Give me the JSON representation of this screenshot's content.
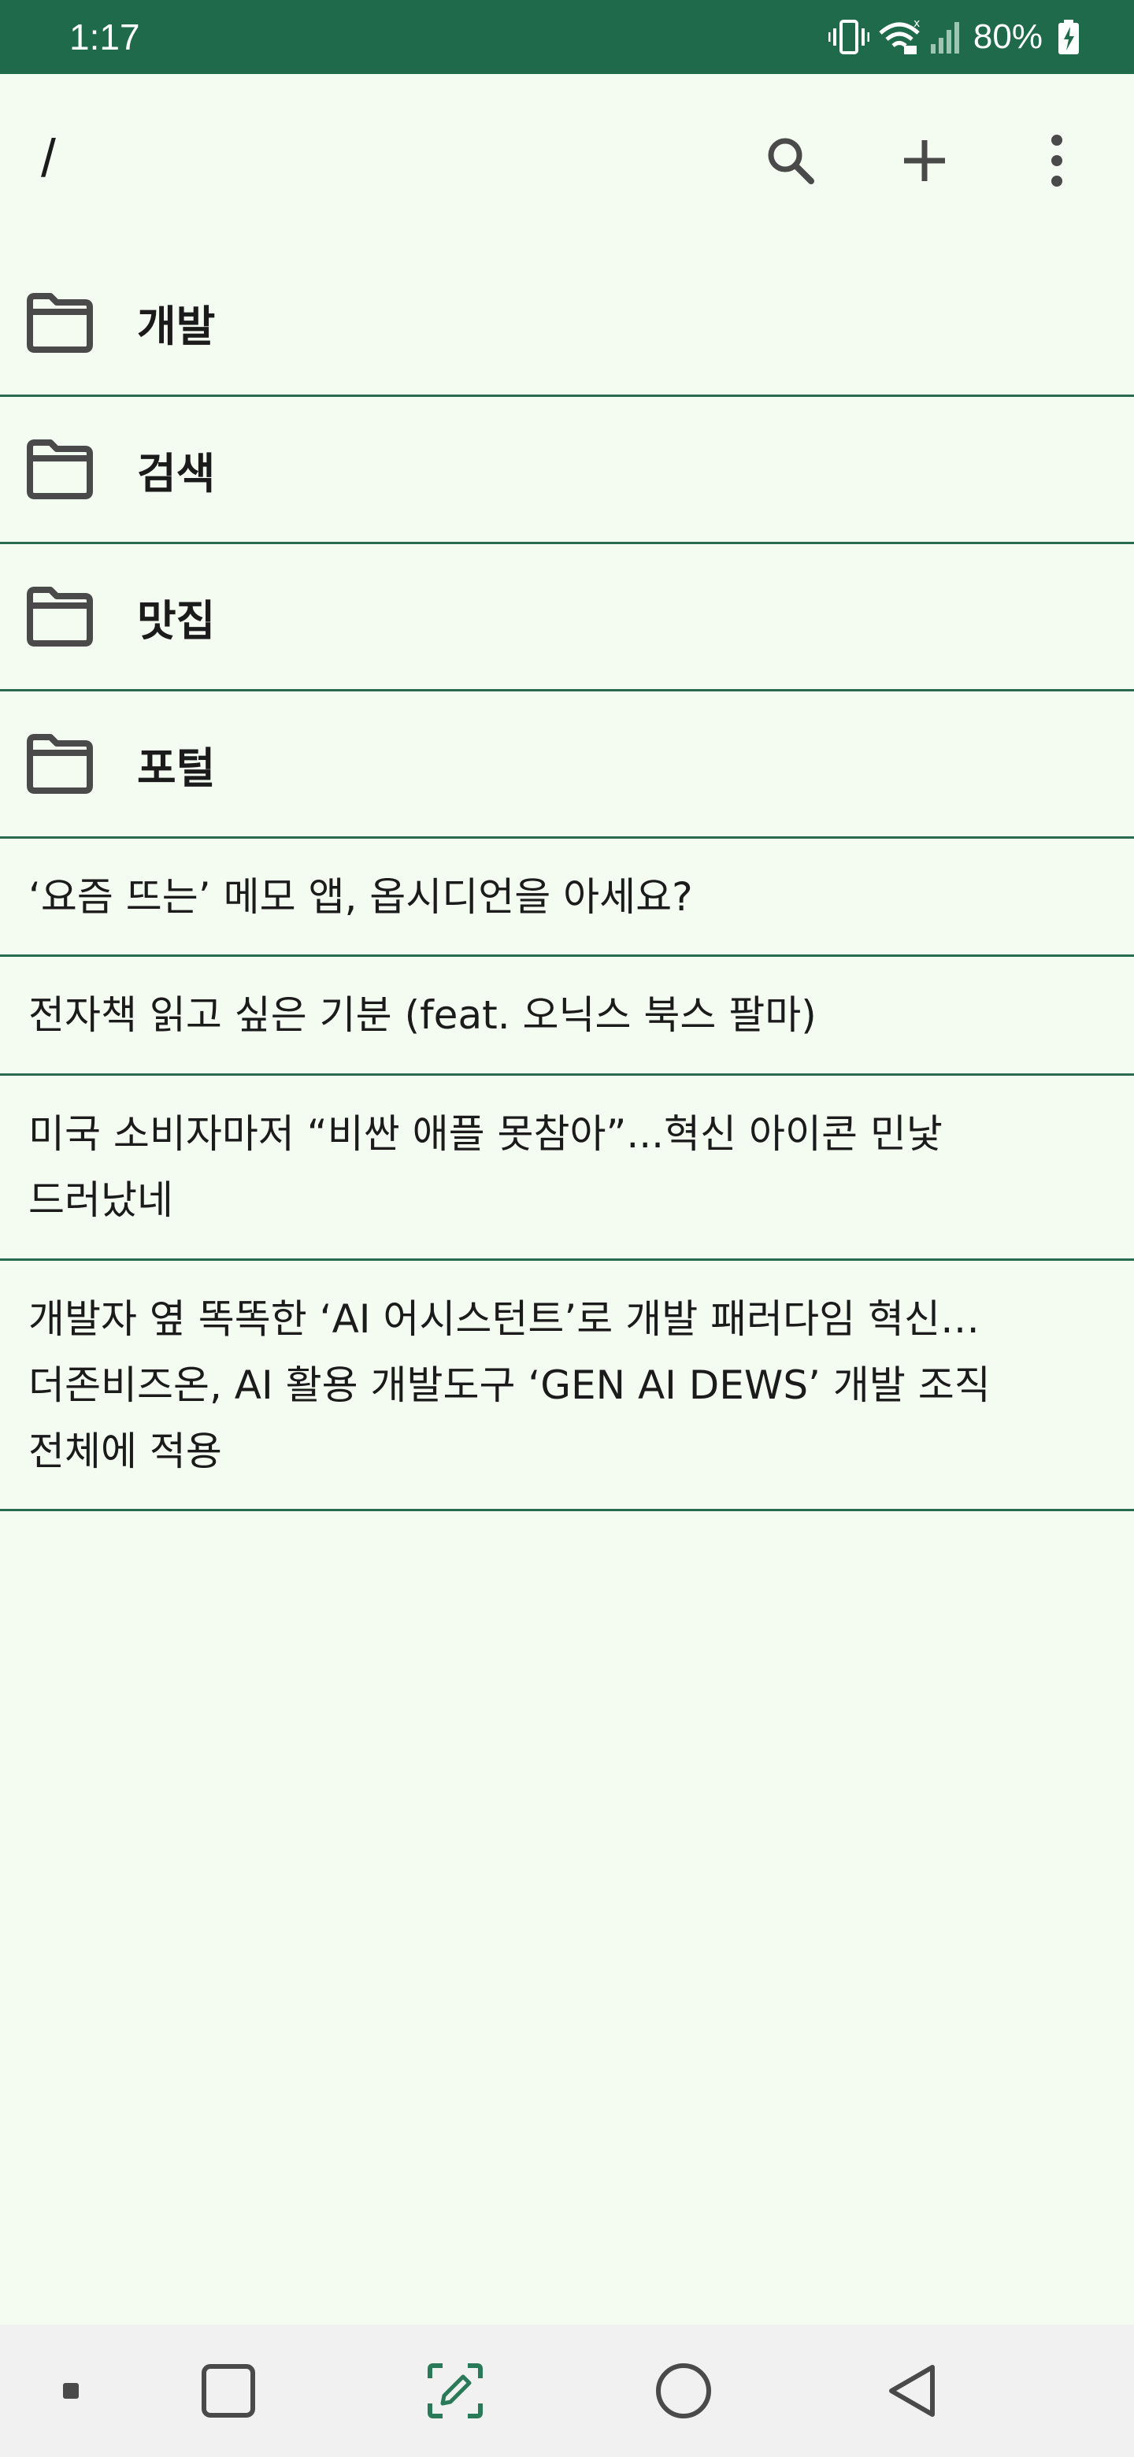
{
  "status_bar": {
    "time": "1:17",
    "battery_percent": "80%",
    "icons": [
      "vibrate-icon",
      "wifi-icon",
      "signal-icon",
      "battery-charging-icon"
    ]
  },
  "app_bar": {
    "title": "/",
    "actions": [
      "search-icon",
      "add-icon",
      "more-vert-icon"
    ]
  },
  "folders": [
    {
      "name": "개발",
      "icon": "folder-icon"
    },
    {
      "name": "검색",
      "icon": "folder-icon"
    },
    {
      "name": "맛집",
      "icon": "folder-icon"
    },
    {
      "name": "포털",
      "icon": "folder-icon"
    }
  ],
  "notes": [
    {
      "title": "‘요즘 뜨는’ 메모 앱, 옵시디언을 아세요?"
    },
    {
      "title": "전자책 읽고 싶은 기분 (feat. 오닉스 북스 팔마)"
    },
    {
      "title": "미국 소비자마저 “비싼 애플 못참아”...혁신 아이콘 민낯\n드러났네"
    },
    {
      "title": "개발자 옆 똑똑한 ‘AI 어시스턴트’로 개발 패러다임 혁신…\n더존비즈온, AI 활용 개발도구 ‘GEN AI DEWS’ 개발 조직\n전체에 적용"
    }
  ],
  "colors": {
    "status_bar": "#1f6a4a",
    "background": "#f4fcf2",
    "divider": "#2a6b4f",
    "icon": "#4a4a4a",
    "nav_bar": "#f1f1f1"
  },
  "nav_bar": {
    "items": [
      "nav-dot-icon",
      "recent-apps-icon",
      "screenshot-edit-icon",
      "home-icon",
      "back-icon"
    ]
  }
}
